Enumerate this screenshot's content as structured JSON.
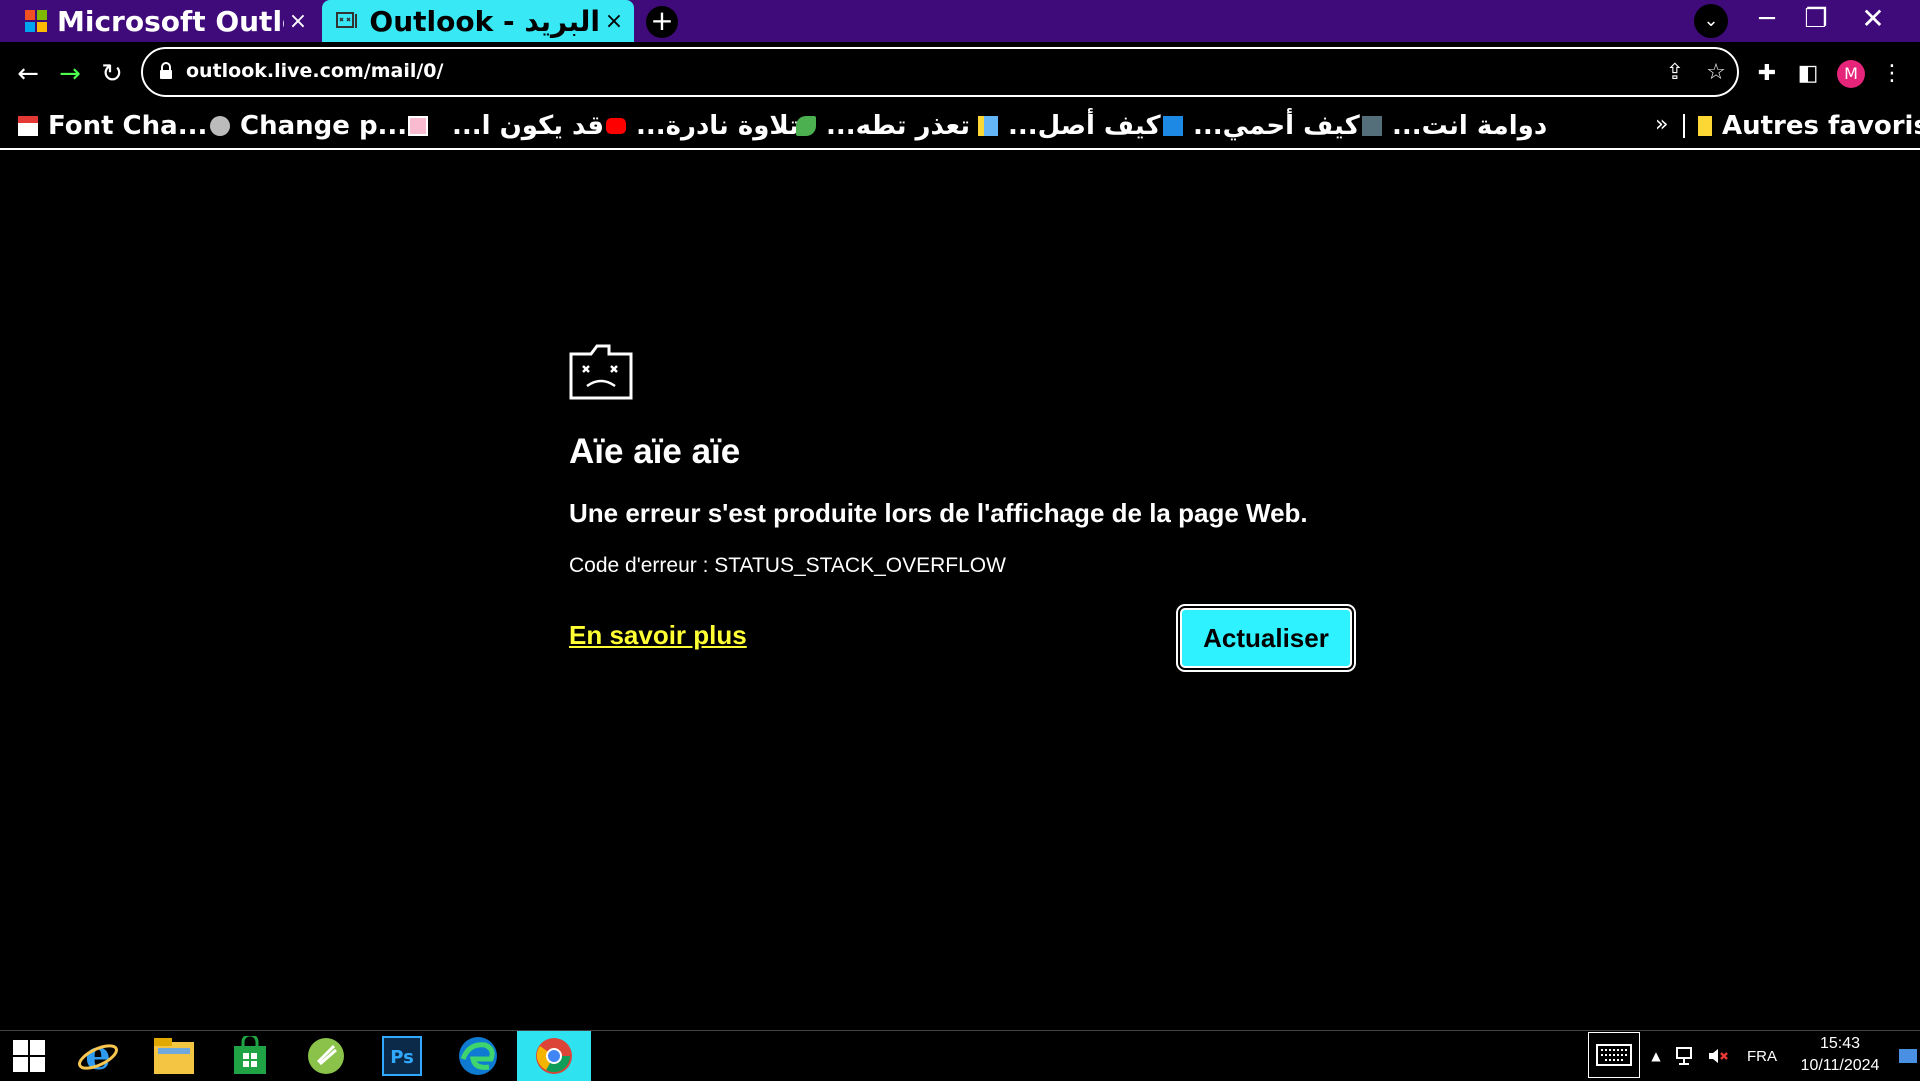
{
  "tabs": [
    {
      "title": "Microsoft Outlook",
      "close": "×"
    },
    {
      "title": "البريد - Outlook",
      "close": "×"
    }
  ],
  "tabstrip": {
    "new_tab": "+",
    "tab_search": "⌄"
  },
  "window_controls": {
    "minimize": "─",
    "maximize": "❐",
    "close": "✕"
  },
  "toolbar": {
    "back": "←",
    "forward": "→",
    "reload": "↻",
    "url": "outlook.live.com/mail/0/",
    "share": "⇪",
    "star": "☆",
    "extensions": "✚",
    "side_panel": "◧",
    "profile_initial": "M",
    "menu": "⋮"
  },
  "bookmarks": [
    {
      "label": "Font Cha...",
      "icon": "red-page-icon"
    },
    {
      "label": "Change p...",
      "icon": "globe-icon"
    },
    {
      "label": "قد يكون ا...",
      "icon": "pink-page-icon"
    },
    {
      "label": "تلاوة نادرة...",
      "icon": "youtube-icon"
    },
    {
      "label": "تعذر تطه...",
      "icon": "green-leaf-icon"
    },
    {
      "label": "كيف أصل...",
      "icon": "blue-book-icon"
    },
    {
      "label": "كيف أحمي...",
      "icon": "blue-square-icon"
    },
    {
      "label": "دوامة انت...",
      "icon": "image-icon"
    }
  ],
  "bookmarks_more": "»",
  "other_bookmarks": "Autres favoris",
  "error": {
    "title": "Aïe aïe aïe",
    "subtitle": "Une erreur s'est produite lors de l'affichage de la page Web.",
    "code": "Code d'erreur : STATUS_STACK_OVERFLOW",
    "learn_more": "En savoir plus",
    "reload_button": "Actualiser"
  },
  "taskbar": {
    "apps": [
      "windows-start",
      "internet-explorer",
      "file-explorer",
      "store",
      "green-app",
      "photoshop",
      "edge",
      "chrome"
    ],
    "tray_up": "▲",
    "language": "FRA",
    "time": "15:43",
    "date": "10/11/2024"
  },
  "colors": {
    "tabstrip": "#3f0a7a",
    "active_tab": "#38e8f4",
    "link": "#ffff33",
    "button": "#2ef2ff",
    "avatar": "#e6247a"
  }
}
